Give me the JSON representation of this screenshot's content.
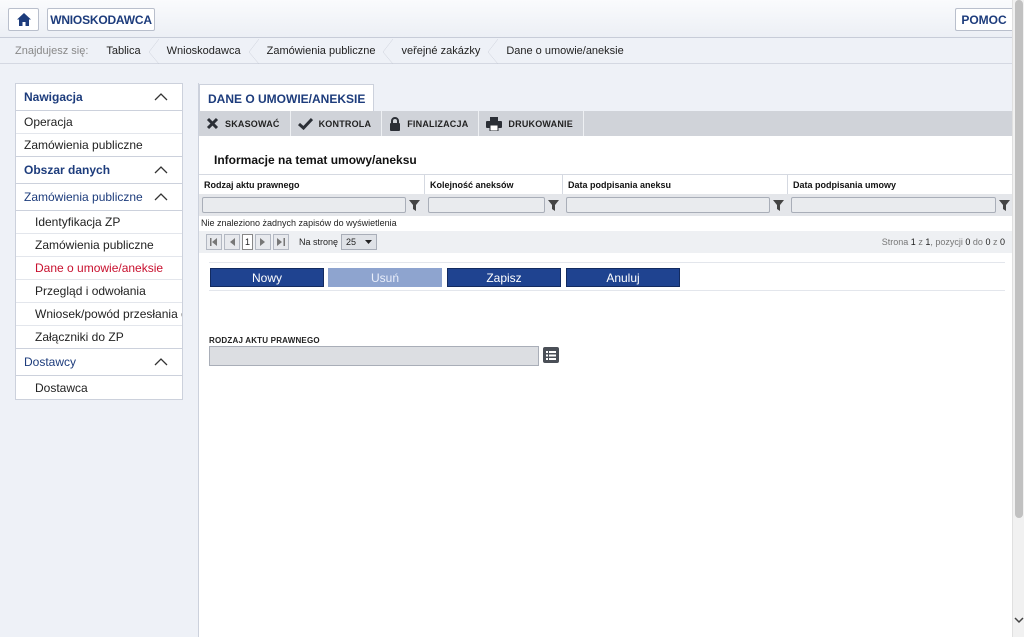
{
  "header": {
    "home_icon": "home-icon",
    "applicant_label": "WNIOSKODAWCA",
    "help_label": "POMOC"
  },
  "breadcrumb": {
    "label": "Znajdujesz się:",
    "items": [
      "Tablica",
      "Wnioskodawca",
      "Zamówienia publiczne",
      "veřejné zakázky",
      "Dane o umowie/aneksie"
    ]
  },
  "sidebar": {
    "navigation_title": "Nawigacja",
    "nav_items": [
      "Operacja",
      "Zamówienia publiczne"
    ],
    "data_area_title": "Obszar danych",
    "group_title": "Zamówienia publiczne",
    "group_items": [
      "Identyfikacja ZP",
      "Zamówienia publiczne",
      "Dane o umowie/aneksie",
      "Przegląd i odwołania",
      "Wniosek/powód przesłania do UOKiK",
      "Załączniki do ZP"
    ],
    "suppliers_title": "Dostawcy",
    "supplier_items": [
      "Dostawca"
    ]
  },
  "main": {
    "tab_label": "DANE O UMOWIE/ANEKSIE",
    "toolbar": {
      "cancel": "SKASOWAĆ",
      "check": "KONTROLA",
      "finalize": "FINALIZACJA",
      "print": "DRUKOWANIE"
    },
    "section_title": "Informacje na temat umowy/aneksu",
    "grid": {
      "columns": [
        "Rodzaj aktu prawnego",
        "Kolejność aneksów",
        "Data podpisania aneksu",
        "Data podpisania umowy"
      ],
      "empty_message": "Nie znaleziono żadnych zapisów do wyświetlenia",
      "pager": {
        "current_page": "1",
        "per_page_label": "Na stronę",
        "per_page_value": "25",
        "info_prefix": "Strona",
        "page": "1",
        "of1": "z",
        "pages": "1",
        "items_label": ", pozycji",
        "from": "0",
        "to_label": "do",
        "to": "0",
        "of2": "z",
        "total": "0"
      }
    },
    "actions": {
      "new": "Nowy",
      "delete": "Usuń",
      "save": "Zapisz",
      "cancel": "Anuluj"
    },
    "field": {
      "label": "RODZAJ AKTU PRAWNEGO",
      "value": ""
    }
  },
  "colors": {
    "brand_blue": "#1d3c7c",
    "button_blue": "#1f4390",
    "active_red": "#c8102e"
  }
}
